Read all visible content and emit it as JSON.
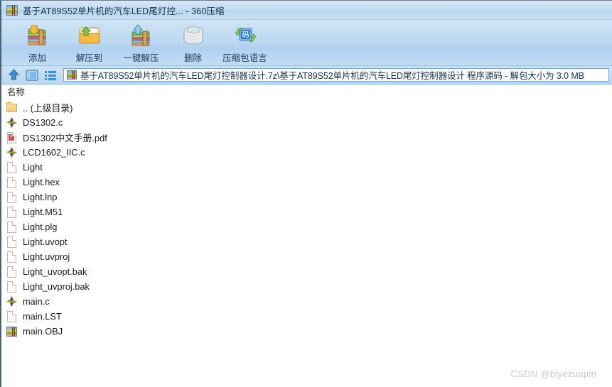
{
  "window": {
    "title": "基于AT89S52单片机的汽车LED尾灯控... - 360压缩",
    "app_icon": "archive-icon"
  },
  "toolbar": {
    "buttons": [
      {
        "label": "添加",
        "icon": "add-to-archive-icon"
      },
      {
        "label": "解压到",
        "icon": "extract-to-folder-icon"
      },
      {
        "label": "一键解压",
        "icon": "one-click-extract-icon"
      },
      {
        "label": "删除",
        "icon": "trash-can-icon"
      },
      {
        "label": "压缩包语言",
        "icon": "archive-language-icon"
      }
    ]
  },
  "navbar": {
    "up_icon": "up-arrow-icon",
    "view_icon": "preview-pane-icon",
    "list_icon": "list-view-icon",
    "path_icon": "archive-icon",
    "path": "基于AT89S52单片机的汽车LED尾灯控制器设计.7z\\基于AT89S52单片机的汽车LED尾灯控制器设计 程序源码 - 解包大小为 3.0 MB"
  },
  "list": {
    "column_header": "名称",
    "rows": [
      {
        "name": ".. (上级目录)",
        "icon": "folder-icon"
      },
      {
        "name": "DS1302.c",
        "icon": "c-source-icon"
      },
      {
        "name": "DS1302中文手册.pdf",
        "icon": "pdf-icon"
      },
      {
        "name": "LCD1602_IIC.c",
        "icon": "c-source-icon"
      },
      {
        "name": "Light",
        "icon": "generic-file-icon"
      },
      {
        "name": "Light.hex",
        "icon": "generic-file-icon"
      },
      {
        "name": "Light.lnp",
        "icon": "generic-file-icon"
      },
      {
        "name": "Light.M51",
        "icon": "generic-file-icon"
      },
      {
        "name": "Light.plg",
        "icon": "generic-file-icon"
      },
      {
        "name": "Light.uvopt",
        "icon": "generic-file-icon"
      },
      {
        "name": "Light.uvproj",
        "icon": "generic-file-icon"
      },
      {
        "name": "Light_uvopt.bak",
        "icon": "generic-file-icon"
      },
      {
        "name": "Light_uvproj.bak",
        "icon": "generic-file-icon"
      },
      {
        "name": "main.c",
        "icon": "c-source-icon"
      },
      {
        "name": "main.LST",
        "icon": "generic-file-icon"
      },
      {
        "name": "main.OBJ",
        "icon": "archive-icon"
      }
    ]
  },
  "watermark": {
    "text": "CSDN @biyezuopin"
  },
  "colors": {
    "titlebar_start": "#d4e6f5",
    "titlebar_end": "#c8e0f3",
    "toolbar_start": "#cfe4f6",
    "toolbar_end": "#c4def5",
    "border": "#4a6178",
    "text": "#1a1a1a",
    "accent_blue": "#2a72b5",
    "watermark": "#c9c9c9"
  }
}
